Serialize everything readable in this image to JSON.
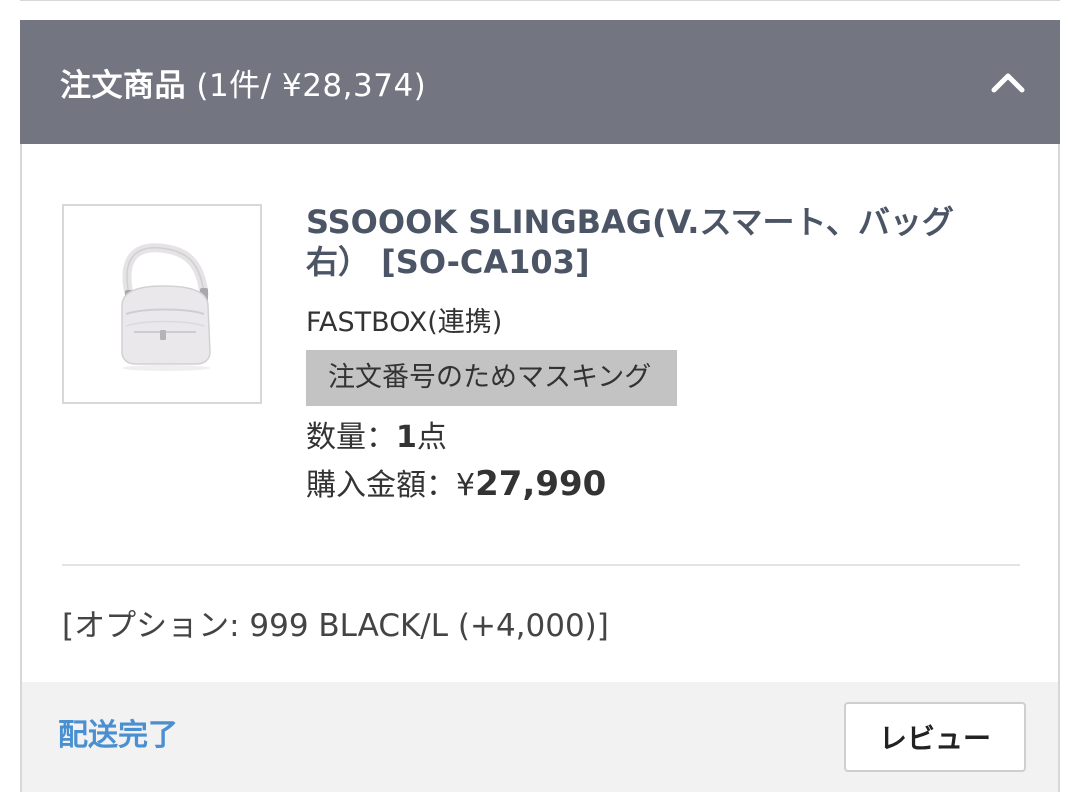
{
  "header": {
    "title": "注文商品",
    "summary": " (1件/ ¥28,374)",
    "collapse_icon": "chevron-up-icon"
  },
  "item": {
    "name": "SSOOOK SLINGBAG(V.スマート、バッグ右） [SO-CA103]",
    "shop": "FASTBOX(連携)",
    "masked_order_number": "注文番号のためマスキング",
    "quantity_label": "数量：",
    "quantity_value": "1",
    "quantity_unit": "点",
    "price_label": "購入金額：",
    "price_currency": "¥",
    "price_value": "27,990",
    "image_icon": "sling-bag-image"
  },
  "option": {
    "text": "[オプション: 999 BLACK/L (+4,000)]"
  },
  "footer": {
    "status": "配送完了",
    "review_label": "レビュー"
  },
  "colors": {
    "header_bg": "#737680",
    "link": "#4a90d0",
    "product_name": "#4b5566",
    "mask_bg": "#c3c3c3",
    "footer_bg": "#f2f2f2"
  }
}
